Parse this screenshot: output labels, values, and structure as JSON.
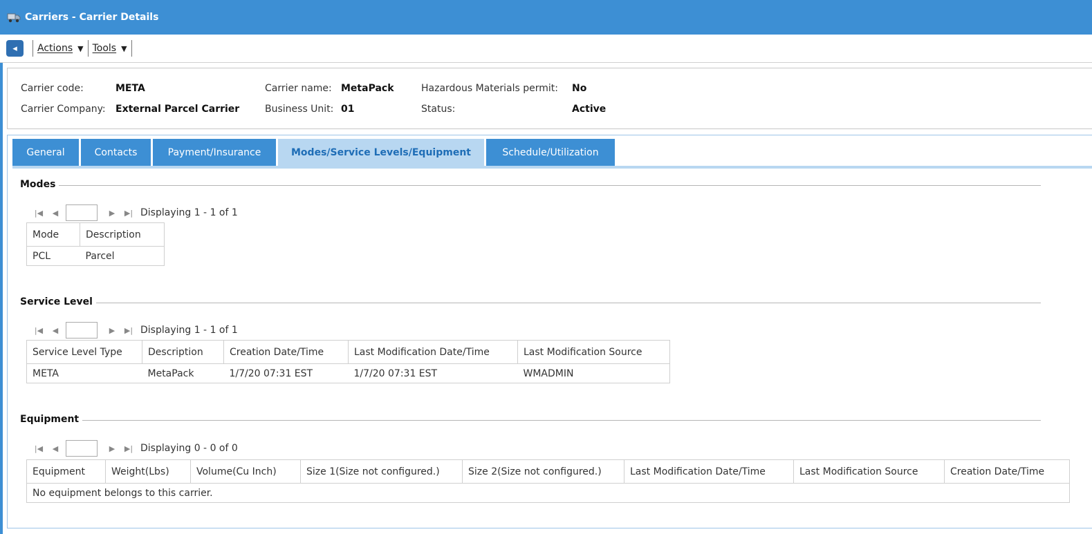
{
  "window": {
    "title": "Carriers - Carrier Details",
    "icon": "truck-icon"
  },
  "toolbar": {
    "actions_label": "Actions",
    "tools_label": "Tools"
  },
  "header": {
    "carrier_code_label": "Carrier code:",
    "carrier_code": "META",
    "carrier_company_label": "Carrier Company:",
    "carrier_company": "External Parcel Carrier",
    "carrier_name_label": "Carrier name:",
    "carrier_name": "MetaPack",
    "business_unit_label": "Business Unit:",
    "business_unit": "01",
    "hazmat_label": "Hazardous Materials permit:",
    "hazmat": "No",
    "status_label": "Status:",
    "status": "Active"
  },
  "tabs": [
    {
      "label": "General"
    },
    {
      "label": "Contacts"
    },
    {
      "label": "Payment/Insurance"
    },
    {
      "label": "Modes/Service Levels/Equipment"
    },
    {
      "label": "Schedule/Utilization"
    }
  ],
  "modes": {
    "title": "Modes",
    "pager_text": "Displaying 1 - 1 of 1",
    "columns": [
      "Mode",
      "Description"
    ],
    "rows": [
      [
        "PCL",
        "Parcel"
      ]
    ]
  },
  "service_level": {
    "title": "Service Level",
    "pager_text": "Displaying 1 - 1 of 1",
    "columns": [
      "Service Level Type",
      "Description",
      "Creation Date/Time",
      "Last Modification Date/Time",
      "Last Modification Source"
    ],
    "rows": [
      [
        "META",
        "MetaPack",
        "1/7/20 07:31 EST",
        "1/7/20 07:31 EST",
        "WMADMIN"
      ]
    ]
  },
  "equipment": {
    "title": "Equipment",
    "pager_text": "Displaying 0 - 0 of 0",
    "columns": [
      "Equipment",
      "Weight(Lbs)",
      "Volume(Cu Inch)",
      "Size 1(Size not configured.)",
      "Size 2(Size not configured.)",
      "Last Modification Date/Time",
      "Last Modification Source",
      "Creation Date/Time"
    ],
    "empty_text": "No equipment belongs to this carrier."
  }
}
